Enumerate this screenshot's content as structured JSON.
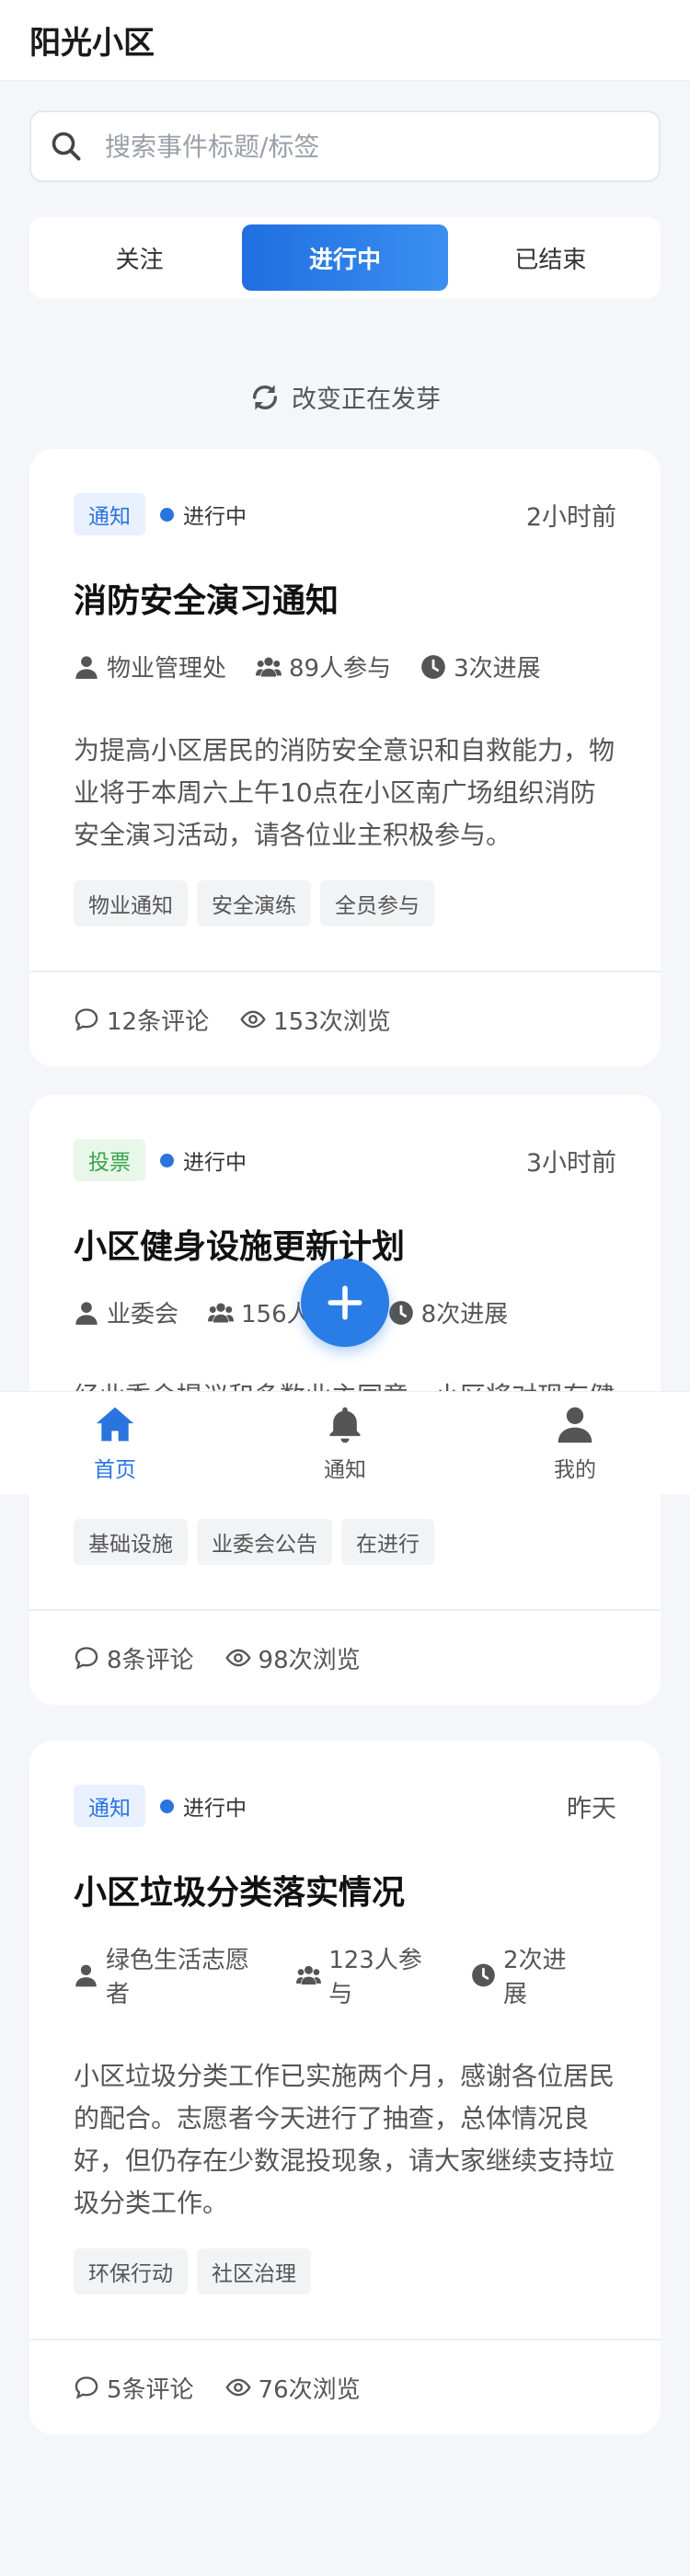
{
  "app": {
    "title": "阳光小区"
  },
  "search": {
    "placeholder": "搜索事件标题/标签"
  },
  "tabs": [
    {
      "label": "关注",
      "active": false
    },
    {
      "label": "进行中",
      "active": true
    },
    {
      "label": "已结束",
      "active": false
    }
  ],
  "refresh": {
    "label": "改变正在发芽"
  },
  "cards": [
    {
      "badge": "通知",
      "status": "进行中",
      "time": "2小时前",
      "title": "消防安全演习通知",
      "author": "物业管理处",
      "participants": "89人参与",
      "progress": "3次进展",
      "description": "为提高小区居民的消防安全意识和自救能力，物业将于本周六上午10点在小区南广场组织消防安全演习活动，请各位业主积极参与。",
      "tags": [
        "物业通知",
        "安全演练",
        "全员参与"
      ],
      "comments": "12条评论",
      "views": "153次浏览"
    },
    {
      "badge": "投票",
      "status": "进行中",
      "time": "3小时前",
      "title": "小区健身设施更新计划",
      "author": "业委会",
      "participants": "156人参与",
      "progress": "8次进展",
      "description": "经业委会提议和多数业主同意，小区将对现有健",
      "tags": [
        "基础设施",
        "业委会公告",
        "在进行"
      ],
      "comments": "8条评论",
      "views": "98次浏览"
    },
    {
      "badge": "通知",
      "status": "进行中",
      "time": "昨天",
      "title": "小区垃圾分类落实情况",
      "author": "绿色生活志愿者",
      "participants": "123人参与",
      "progress": "2次进展",
      "description": "小区垃圾分类工作已实施两个月，感谢各位居民的配合。志愿者今天进行了抽查，总体情况良好，但仍存在少数混投现象，请大家继续支持垃圾分类工作。",
      "tags": [
        "环保行动",
        "社区治理"
      ],
      "comments": "5条评论",
      "views": "76次浏览"
    }
  ],
  "nav": [
    {
      "label": "首页",
      "icon": "home-icon",
      "active": true
    },
    {
      "label": "通知",
      "icon": "bell-icon",
      "active": false
    },
    {
      "label": "我的",
      "icon": "user-icon",
      "active": false
    }
  ],
  "colors": {
    "accent": "#2a74de",
    "vote": "#3aa34b",
    "background": "#f4f6fa"
  }
}
